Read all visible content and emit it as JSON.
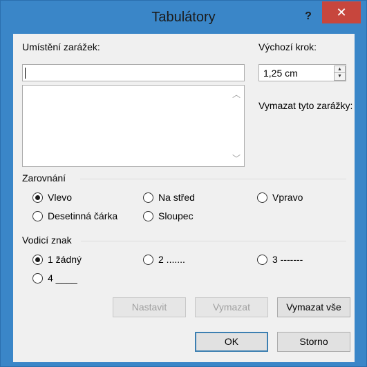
{
  "window": {
    "title": "Tabulátory",
    "help_icon": "?",
    "close_icon": "✕"
  },
  "tab_stop": {
    "label": "Umístění zarážek:",
    "value": ""
  },
  "default_step": {
    "label": "Výchozí krok:",
    "value": "1,25 cm"
  },
  "clear_label": "Vymazat tyto zarážky:",
  "alignment": {
    "title": "Zarovnání",
    "options": [
      {
        "label": "Vlevo",
        "checked": true
      },
      {
        "label": "Na střed",
        "checked": false
      },
      {
        "label": "Vpravo",
        "checked": false
      },
      {
        "label": "Desetinná čárka",
        "checked": false
      },
      {
        "label": "Sloupec",
        "checked": false
      }
    ]
  },
  "leader": {
    "title": "Vodicí znak",
    "options": [
      {
        "label": "1 žádný",
        "checked": true
      },
      {
        "label": "2 .......",
        "checked": false
      },
      {
        "label": "3 -------",
        "checked": false
      },
      {
        "label": "4 ____",
        "checked": false
      }
    ]
  },
  "buttons": {
    "set": "Nastavit",
    "clear": "Vymazat",
    "clear_all": "Vymazat vše",
    "ok": "OK",
    "cancel": "Storno"
  }
}
